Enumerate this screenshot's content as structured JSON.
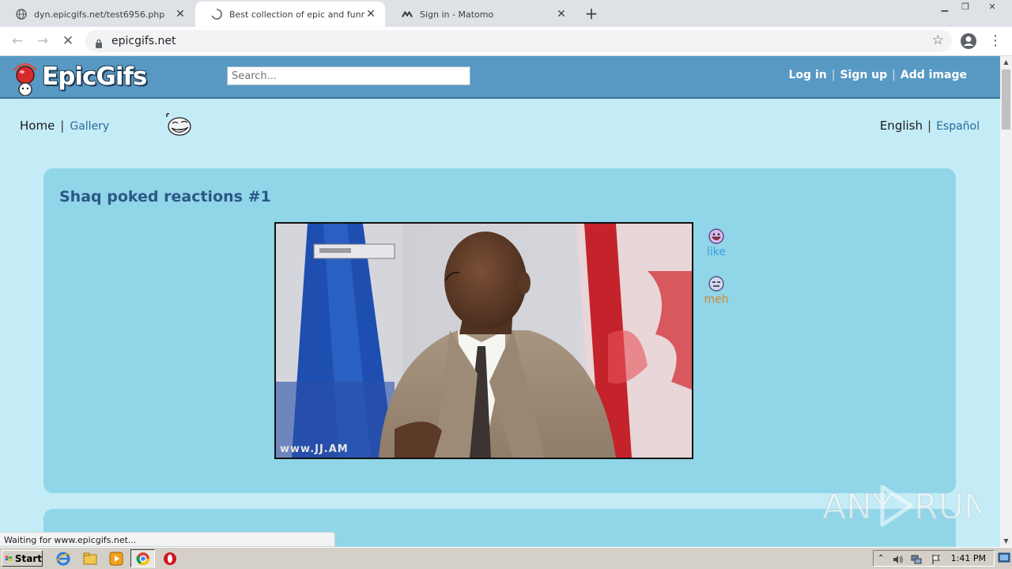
{
  "browser": {
    "tabs": [
      {
        "label": "dyn.epicgifs.net/test6956.php",
        "icon": "globe-icon",
        "active": false
      },
      {
        "label": "Best collection of epic and funny gifs",
        "icon": "loading-spinner-icon",
        "active": true
      },
      {
        "label": "Sign in - Matomo",
        "icon": "matomo-icon",
        "active": false
      }
    ],
    "url": "epicgifs.net",
    "status_text": "Waiting for www.epicgifs.net..."
  },
  "site": {
    "logo_text": "EpicGifs",
    "search_placeholder": "Search...",
    "auth": {
      "login": "Log in",
      "signup": "Sign up",
      "add_image": "Add image"
    },
    "nav": {
      "home": "Home",
      "gallery": "Gallery"
    },
    "languages": {
      "english": "English",
      "spanish": "Español"
    }
  },
  "post": {
    "title": "Shaq poked reactions #1",
    "watermark": "www.JJ.AM",
    "votes": [
      {
        "label": "like",
        "color": "#3aa0e0"
      },
      {
        "label": "meh",
        "color": "#d4862e"
      }
    ]
  },
  "watermark": {
    "text": "ANY RUN"
  },
  "taskbar": {
    "start_label": "Start",
    "clock": "1:41 PM"
  }
}
